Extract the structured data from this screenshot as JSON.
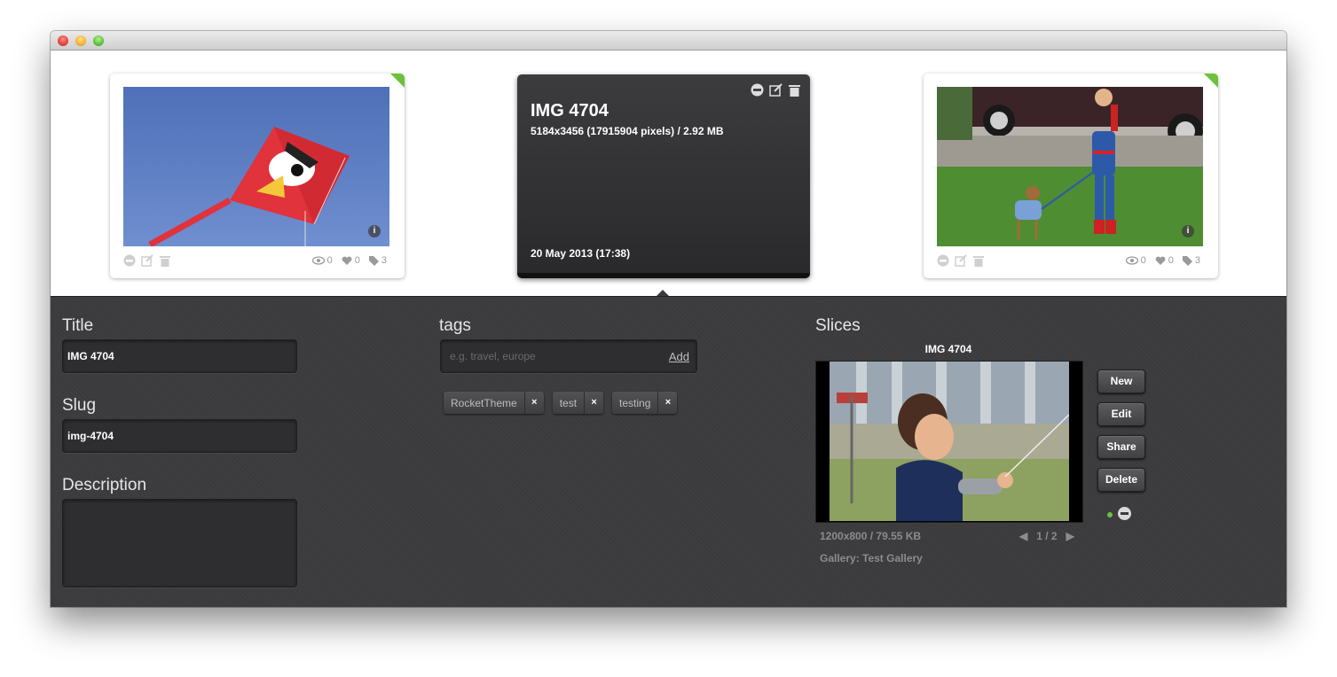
{
  "colors": {
    "accent_green": "#6cc13a",
    "panel_bg": "#3b3b3d",
    "card_dark": "#2e2e30"
  },
  "thumbnails": [
    {
      "views": "0",
      "likes": "0",
      "tags": "3",
      "info_icon": "i"
    },
    {
      "views": "0",
      "likes": "0",
      "tags": "3",
      "info_icon": "i"
    }
  ],
  "active_image": {
    "title": "IMG 4704",
    "meta": "5184x3456 (17915904 pixels) / 2.92 MB",
    "date": "20 May 2013 (17:38)"
  },
  "form": {
    "title_label": "Title",
    "title_value": "IMG 4704",
    "slug_label": "Slug",
    "slug_value": "img-4704",
    "description_label": "Description",
    "description_value": ""
  },
  "tags": {
    "label": "tags",
    "placeholder": "e.g. travel, europe",
    "add_label": "Add",
    "items": [
      {
        "name": "RocketTheme",
        "remove": "×"
      },
      {
        "name": "test",
        "remove": "×"
      },
      {
        "name": "testing",
        "remove": "×"
      }
    ]
  },
  "slices": {
    "label": "Slices",
    "title": "IMG 4704",
    "dimensions": "1200x800 / 79.55 KB",
    "pager": "1 / 2",
    "prev": "◀",
    "next": "▶",
    "gallery": "Gallery: Test Gallery",
    "buttons": {
      "new": "New",
      "edit": "Edit",
      "share": "Share",
      "delete": "Delete"
    }
  }
}
